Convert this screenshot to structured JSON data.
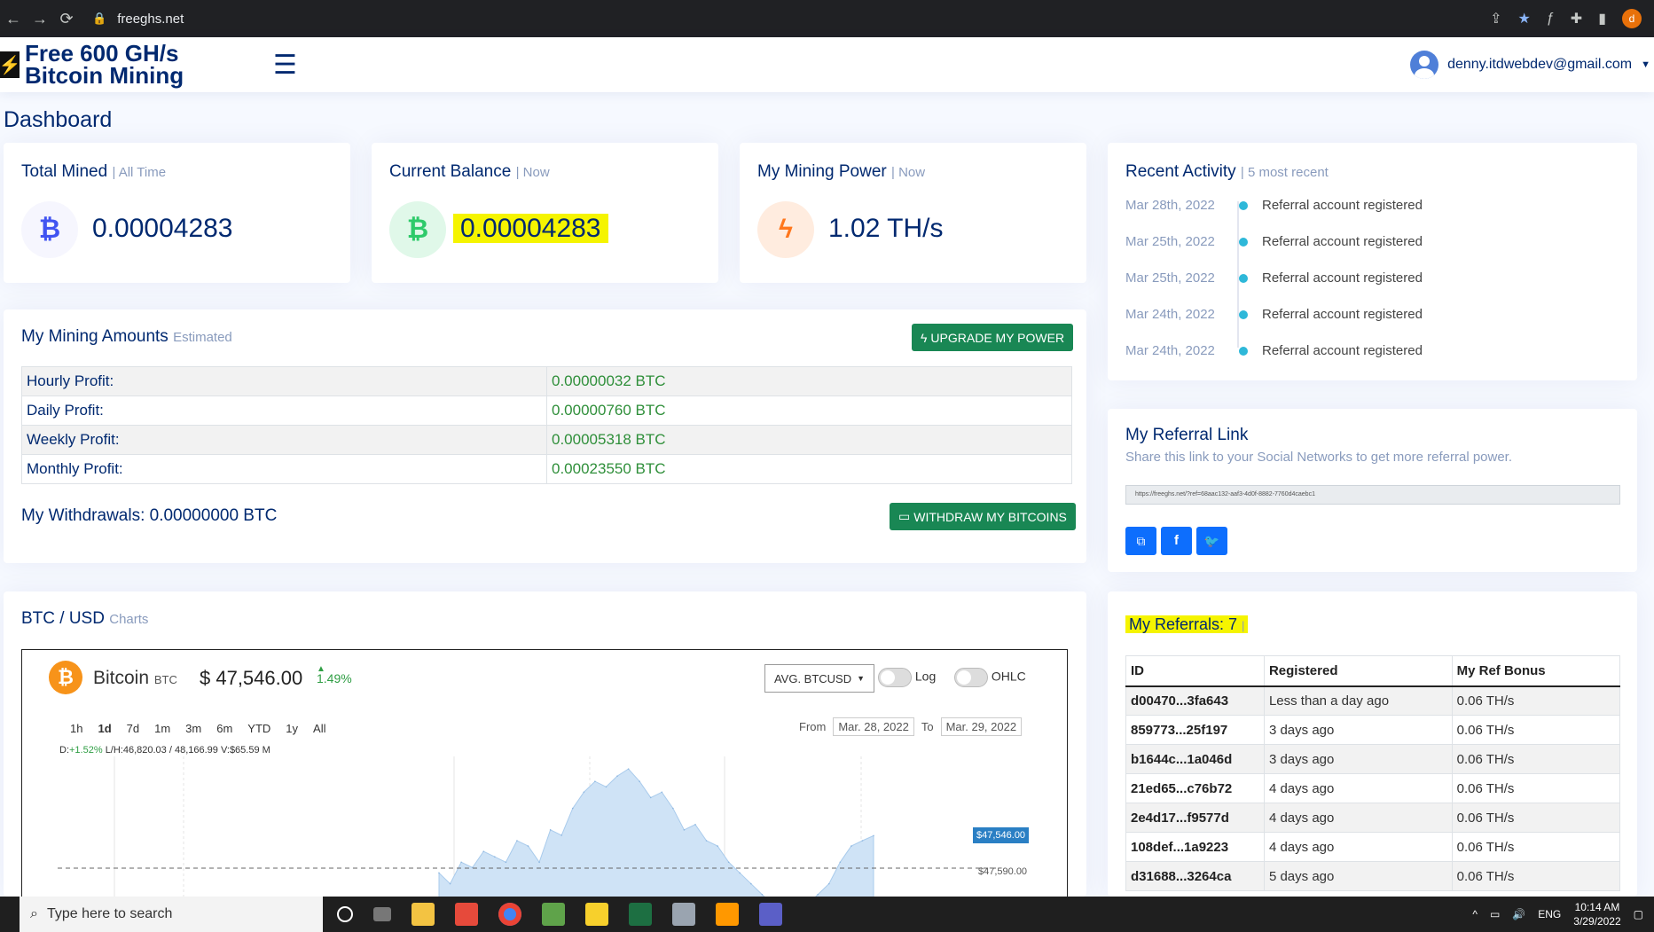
{
  "browser": {
    "url": "freeghs.net",
    "profile_initial": "d"
  },
  "header": {
    "logo_line1": "Free 600 GH/s",
    "logo_line2": "Bitcoin Mining",
    "user_email": "denny.itdwebdev@gmail.com"
  },
  "page_title": "Dashboard",
  "stats": {
    "total_mined": {
      "title": "Total Mined",
      "sub": "| All Time",
      "value": "0.00004283"
    },
    "current_balance": {
      "title": "Current Balance",
      "sub": "| Now",
      "value": "0.00004283"
    },
    "mining_power": {
      "title": "My Mining Power",
      "sub": "| Now",
      "value": "1.02 TH/s"
    }
  },
  "mining": {
    "title": "My Mining Amounts",
    "sub": "Estimated",
    "upgrade_label": "UPGRADE MY POWER",
    "rows": [
      {
        "label": "Hourly Profit:",
        "value": "0.00000032 BTC"
      },
      {
        "label": "Daily Profit:",
        "value": "0.00000760 BTC"
      },
      {
        "label": "Weekly Profit:",
        "value": "0.00005318 BTC"
      },
      {
        "label": "Monthly Profit:",
        "value": "0.00023550 BTC"
      }
    ],
    "withdrawals": "My Withdrawals: 0.00000000 BTC",
    "withdraw_label": "WITHDRAW MY BITCOINS"
  },
  "chart_section": {
    "title": "BTC / USD",
    "sub": "Charts",
    "coin_name": "Bitcoin",
    "coin_symbol": "BTC",
    "price": "$ 47,546.00",
    "change": "1.49%",
    "avg_select": "AVG. BTCUSD",
    "log_label": "Log",
    "ohlc_label": "OHLC",
    "ranges": [
      "1h",
      "1d",
      "7d",
      "1m",
      "3m",
      "6m",
      "YTD",
      "1y",
      "All"
    ],
    "from_label": "From",
    "from_value": "Mar. 28, 2022",
    "to_label": "To",
    "to_value": "Mar. 29, 2022",
    "stats_d_label": "D:",
    "stats_d_value": "+1.52%",
    "stats_rest": "L/H:46,820.03 / 48,166.99  V:$65.59 M",
    "current_label": "$47,546.00",
    "ref_label": "$47,590.00"
  },
  "chart_data": {
    "type": "area",
    "title": "",
    "x": [
      0,
      1,
      2,
      3,
      4,
      5,
      6,
      7,
      8,
      9,
      10,
      11,
      12,
      13,
      14,
      15,
      16,
      17,
      18,
      19,
      20,
      21,
      22,
      23,
      24,
      25,
      26,
      27,
      28,
      29,
      30,
      31,
      32,
      33,
      34,
      35,
      36,
      37,
      38,
      39
    ],
    "series": [
      {
        "values": [
          47200,
          47100,
          47300,
          47250,
          47400,
          47350,
          47300,
          47500,
          47450,
          47300,
          47600,
          47550,
          47800,
          47950,
          48050,
          48000,
          48100,
          48166,
          48050,
          47900,
          47950,
          47800,
          47600,
          47650,
          47500,
          47450,
          47300,
          47200,
          47100,
          47000,
          46900,
          46850,
          46820,
          46900,
          47000,
          47100,
          47300,
          47450,
          47500,
          47546
        ]
      }
    ],
    "ylim": [
      46800,
      48200
    ],
    "grid": true
  },
  "activity": {
    "title": "Recent Activity",
    "sub": "| 5 most recent",
    "items": [
      {
        "date": "Mar 28th, 2022",
        "text": "Referral account registered"
      },
      {
        "date": "Mar 25th, 2022",
        "text": "Referral account registered"
      },
      {
        "date": "Mar 25th, 2022",
        "text": "Referral account registered"
      },
      {
        "date": "Mar 24th, 2022",
        "text": "Referral account registered"
      },
      {
        "date": "Mar 24th, 2022",
        "text": "Referral account registered"
      }
    ]
  },
  "referral_link": {
    "title": "My Referral Link",
    "sub": "Share this link to your Social Networks to get more referral power.",
    "url": "https://freeghs.net/?ref=68aac132-aaf3-4d0f-8882-7760d4caebc1"
  },
  "referrals": {
    "title": "My Referrals: 7",
    "sep": "|",
    "headers": [
      "ID",
      "Registered",
      "My Ref Bonus"
    ],
    "rows": [
      [
        "d00470...3fa643",
        "Less than a day ago",
        "0.06 TH/s"
      ],
      [
        "859773...25f197",
        "3 days ago",
        "0.06 TH/s"
      ],
      [
        "b1644c...1a046d",
        "3 days ago",
        "0.06 TH/s"
      ],
      [
        "21ed65...c76b72",
        "4 days ago",
        "0.06 TH/s"
      ],
      [
        "2e4d17...f9577d",
        "4 days ago",
        "0.06 TH/s"
      ],
      [
        "108def...1a9223",
        "4 days ago",
        "0.06 TH/s"
      ],
      [
        "d31688...3264ca",
        "5 days ago",
        "0.06 TH/s"
      ]
    ]
  },
  "taskbar": {
    "search_placeholder": "Type here to search",
    "lang": "ENG",
    "time": "10:14 AM",
    "date": "3/29/2022"
  }
}
